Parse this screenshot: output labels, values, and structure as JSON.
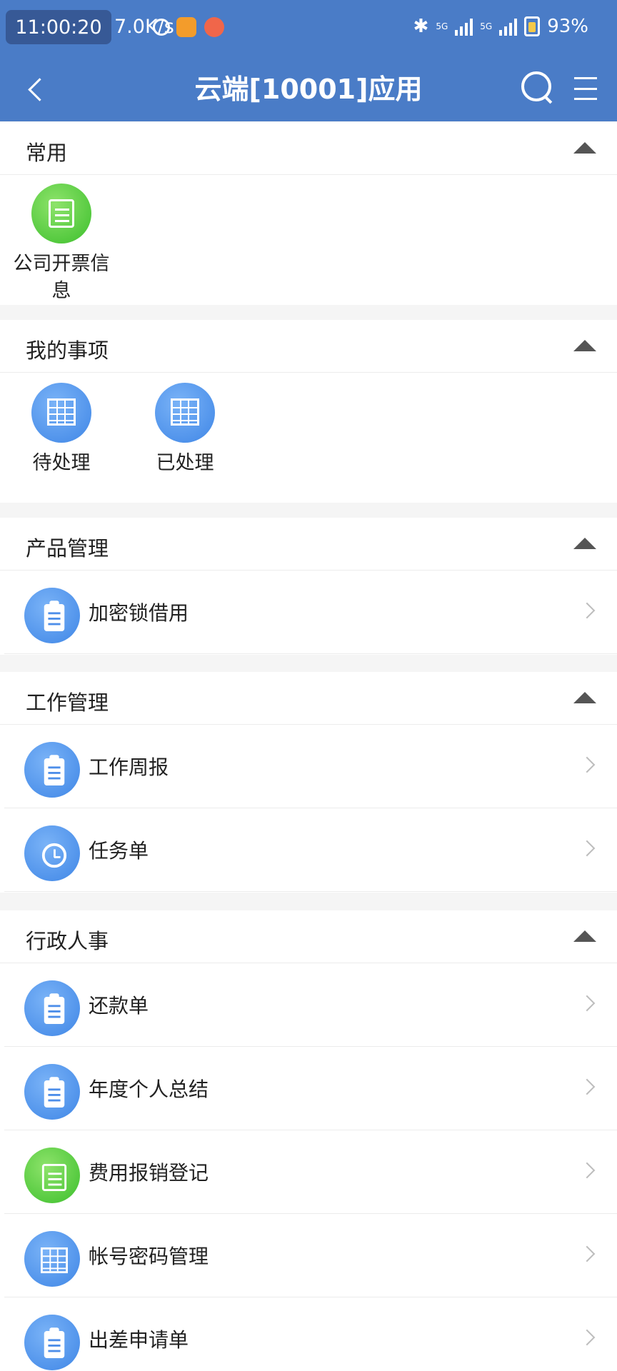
{
  "status_bar": {
    "time": "11:00:20",
    "net_speed": "7.0K/s",
    "network_1": "5G",
    "network_2": "5G",
    "battery": "93%"
  },
  "header": {
    "title": "云端[10001]应用",
    "icons": [
      "back-arrow-icon",
      "search-icon",
      "menu-icon"
    ]
  },
  "colors": {
    "header_bg": "#4a7cc7",
    "green_icon": "#4cc93a",
    "blue_icon": "#4d8ee9"
  },
  "sections": {
    "common": {
      "title": "常用",
      "items": [
        {
          "label_line1": "公司开票信",
          "label_line2": "息",
          "icon": "notepad-icon"
        }
      ]
    },
    "my_items": {
      "title": "我的事项",
      "items": [
        {
          "label": "待处理",
          "icon": "table-icon"
        },
        {
          "label": "已处理",
          "icon": "table-icon"
        }
      ]
    },
    "product": {
      "title": "产品管理",
      "items": [
        {
          "label": "加密锁借用",
          "icon": "clipboard-icon"
        }
      ]
    },
    "work": {
      "title": "工作管理",
      "items": [
        {
          "label": "工作周报",
          "icon": "clipboard-icon"
        },
        {
          "label": "任务单",
          "icon": "alarm-clock-icon"
        }
      ]
    },
    "admin": {
      "title": "行政人事",
      "items": [
        {
          "label": "还款单",
          "icon": "clipboard-icon"
        },
        {
          "label": "年度个人总结",
          "icon": "clipboard-icon"
        },
        {
          "label": "费用报销登记",
          "icon": "notepad-icon"
        },
        {
          "label": "帐号密码管理",
          "icon": "table-icon"
        },
        {
          "label": "出差申请单",
          "icon": "clipboard-icon"
        }
      ]
    }
  }
}
